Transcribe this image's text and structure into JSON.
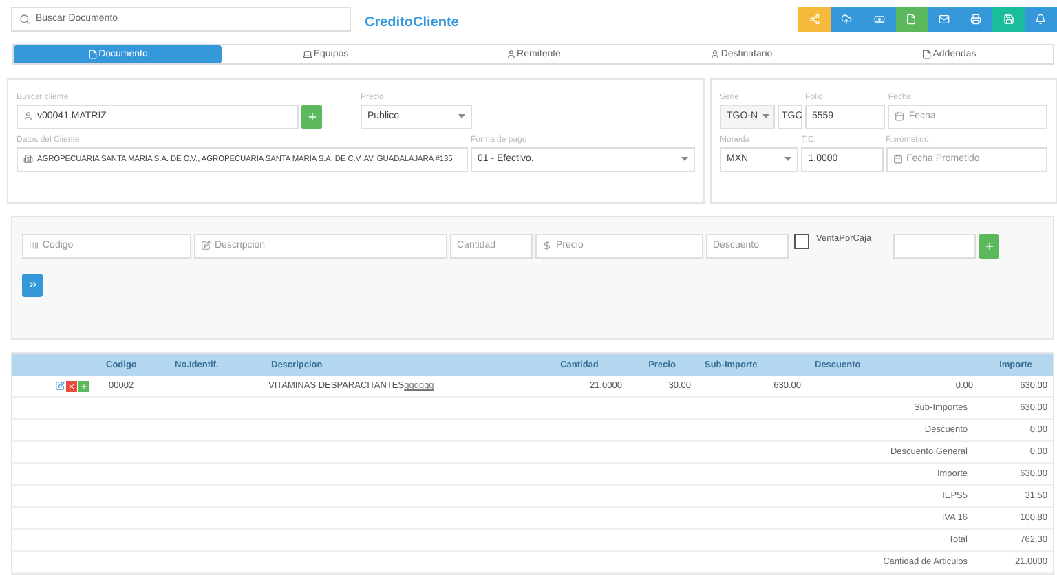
{
  "header": {
    "search": {
      "placeholder": "Buscar Documento"
    },
    "title": "CreditoCliente",
    "toolbar": [
      {
        "kind": "share",
        "color": "#f6b93b"
      },
      {
        "kind": "upload",
        "color": "#3498db"
      },
      {
        "kind": "money",
        "color": "#3498db"
      },
      {
        "kind": "file",
        "color": "#5cb85c"
      },
      {
        "kind": "mail",
        "color": "#3498db"
      },
      {
        "kind": "print",
        "color": "#3498db"
      },
      {
        "kind": "save",
        "color": "#1abc9c"
      },
      {
        "kind": "bell",
        "color": "#3498db"
      }
    ]
  },
  "tabs": [
    {
      "label": "Documento",
      "kind": "file",
      "selected": true
    },
    {
      "label": "Equipos",
      "kind": "laptop",
      "selected": false
    },
    {
      "label": "Remitente",
      "kind": "user",
      "selected": false
    },
    {
      "label": "Destinatario",
      "kind": "user",
      "selected": false
    },
    {
      "label": "Addendas",
      "kind": "file",
      "selected": false
    }
  ],
  "client_panel": {
    "client": {
      "label": "Buscar cliente",
      "value": "v00041.MATRIZ"
    },
    "price": {
      "label": "Precio",
      "value": "Publico"
    },
    "client_data": {
      "label": "Datos del Cliente",
      "value": "AGROPECUARIA SANTA MARIA S.A. DE C.V., AGROPECUARIA SANTA MARIA S.A.  DE C.V. AV. GUADALAJARA  #135"
    },
    "payment": {
      "label": "Forma de pago",
      "value": "01 - Efectivo."
    }
  },
  "doc_panel": {
    "serie": {
      "label": "Serie",
      "value": "TGO-N",
      "code": "TGC"
    },
    "folio": {
      "label": "Folio",
      "value": "5559"
    },
    "date": {
      "label": "Fecha",
      "placeholder": "Fecha"
    },
    "currency": {
      "label": "Moneda",
      "value": "MXN"
    },
    "rate": {
      "label": "T.C.",
      "value": "1.0000"
    },
    "promised": {
      "label": "F.prometido",
      "placeholder": "Fecha Prometido"
    }
  },
  "item_entry": {
    "code": {
      "placeholder": "Codigo"
    },
    "description": {
      "placeholder": "Descripcion"
    },
    "quantity": {
      "placeholder": "Cantidad"
    },
    "price": {
      "placeholder": "Precio"
    },
    "discount": {
      "placeholder": "Descuento"
    },
    "box_sale": {
      "label": "VentaPorCaja",
      "checked": false
    }
  },
  "table": {
    "columns": [
      "Codigo",
      "No.Identif.",
      "Descripcion",
      "Cantidad",
      "Precio",
      "Sub-Importe",
      "Descuento",
      "Importe"
    ],
    "rows": [
      {
        "code": "00002",
        "id": "",
        "description": "VITAMINAS DESPARACITANTES",
        "description_extra": "gggggg",
        "quantity": "21.0000",
        "price": "30.00",
        "subtotal": "630.00",
        "discount": "0.00",
        "amount": "630.00"
      }
    ],
    "summary": [
      {
        "label": "Sub-Importes",
        "value": "630.00"
      },
      {
        "label": "Descuento",
        "value": "0.00"
      },
      {
        "label": "Descuento General",
        "value": "0.00"
      },
      {
        "label": "Importe",
        "value": "630.00"
      },
      {
        "label": "IEPS5",
        "value": "31.50"
      },
      {
        "label": "IVA 16",
        "value": "100.80"
      },
      {
        "label": "Total",
        "value": "762.30"
      },
      {
        "label": "Cantidad de Articulos",
        "value": "21.0000"
      }
    ]
  }
}
